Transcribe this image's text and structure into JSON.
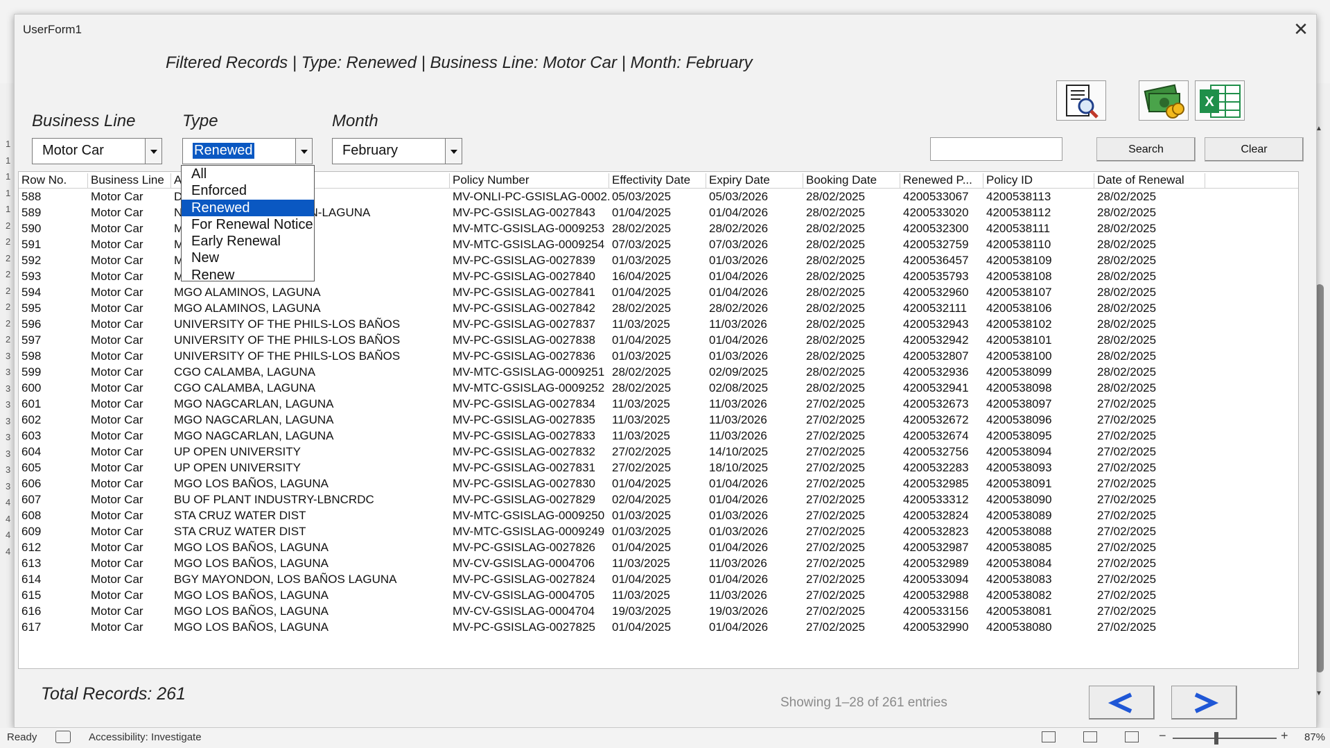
{
  "window": {
    "title": "UserForm1",
    "close_glyph": "✕"
  },
  "filter_title": "Filtered Records | Type: Renewed | Business Line: Motor Car | Month: February",
  "labels": {
    "business_line": "Business Line",
    "type": "Type",
    "month": "Month"
  },
  "business_line_select": {
    "value": "Motor Car"
  },
  "type_select": {
    "value": "Renewed",
    "options": [
      "All",
      "Enforced",
      "Renewed",
      "For Renewal Notice",
      "Early Renewal",
      "New",
      "Renew"
    ],
    "highlighted": "Renewed"
  },
  "month_select": {
    "value": "February"
  },
  "search": {
    "value": "",
    "button_label": "Search",
    "clear_label": "Clear"
  },
  "icons": {
    "preview": "report-search-icon",
    "money": "money-icon",
    "excel": "excel-icon"
  },
  "table": {
    "columns": [
      "Row No.",
      "Business Line",
      "A",
      "Policy Number",
      "Effectivity Date",
      "Expiry Date",
      "Booking Date",
      "Renewed P...",
      "Policy ID",
      "Date of Renewal"
    ],
    "rows": [
      [
        "588",
        "Motor Car",
        "D",
        "MV-ONLI-PC-GSISLAG-0002...",
        "05/03/2025",
        "05/03/2026",
        "28/02/2025",
        "4200533067",
        "4200538113",
        "28/02/2025"
      ],
      [
        "589",
        "Motor Car",
        "N                                    ON-LAGUNA",
        "MV-PC-GSISLAG-0027843",
        "01/04/2025",
        "01/04/2026",
        "28/02/2025",
        "4200533020",
        "4200538112",
        "28/02/2025"
      ],
      [
        "590",
        "Motor Car",
        "M",
        "MV-MTC-GSISLAG-0009253",
        "28/02/2025",
        "28/02/2026",
        "28/02/2025",
        "4200532300",
        "4200538111",
        "28/02/2025"
      ],
      [
        "591",
        "Motor Car",
        "M",
        "MV-MTC-GSISLAG-0009254",
        "07/03/2025",
        "07/03/2026",
        "28/02/2025",
        "4200532759",
        "4200538110",
        "28/02/2025"
      ],
      [
        "592",
        "Motor Car",
        "M",
        "MV-PC-GSISLAG-0027839",
        "01/03/2025",
        "01/03/2026",
        "28/02/2025",
        "4200536457",
        "4200538109",
        "28/02/2025"
      ],
      [
        "593",
        "Motor Car",
        "M                                    A",
        "MV-PC-GSISLAG-0027840",
        "16/04/2025",
        "01/04/2026",
        "28/02/2025",
        "4200535793",
        "4200538108",
        "28/02/2025"
      ],
      [
        "594",
        "Motor Car",
        "MGO ALAMINOS, LAGUNA",
        "MV-PC-GSISLAG-0027841",
        "01/04/2025",
        "01/04/2026",
        "28/02/2025",
        "4200532960",
        "4200538107",
        "28/02/2025"
      ],
      [
        "595",
        "Motor Car",
        "MGO ALAMINOS, LAGUNA",
        "MV-PC-GSISLAG-0027842",
        "28/02/2025",
        "28/02/2026",
        "28/02/2025",
        "4200532111",
        "4200538106",
        "28/02/2025"
      ],
      [
        "596",
        "Motor Car",
        "UNIVERSITY OF THE PHILS-LOS BAÑOS",
        "MV-PC-GSISLAG-0027837",
        "11/03/2025",
        "11/03/2026",
        "28/02/2025",
        "4200532943",
        "4200538102",
        "28/02/2025"
      ],
      [
        "597",
        "Motor Car",
        "UNIVERSITY OF THE PHILS-LOS BAÑOS",
        "MV-PC-GSISLAG-0027838",
        "01/04/2025",
        "01/04/2026",
        "28/02/2025",
        "4200532942",
        "4200538101",
        "28/02/2025"
      ],
      [
        "598",
        "Motor Car",
        "UNIVERSITY OF THE PHILS-LOS BAÑOS",
        "MV-PC-GSISLAG-0027836",
        "01/03/2025",
        "01/03/2026",
        "28/02/2025",
        "4200532807",
        "4200538100",
        "28/02/2025"
      ],
      [
        "599",
        "Motor Car",
        "CGO CALAMBA, LAGUNA",
        "MV-MTC-GSISLAG-0009251",
        "28/02/2025",
        "02/09/2025",
        "28/02/2025",
        "4200532936",
        "4200538099",
        "28/02/2025"
      ],
      [
        "600",
        "Motor Car",
        "CGO CALAMBA, LAGUNA",
        "MV-MTC-GSISLAG-0009252",
        "28/02/2025",
        "02/08/2025",
        "28/02/2025",
        "4200532941",
        "4200538098",
        "28/02/2025"
      ],
      [
        "601",
        "Motor Car",
        "MGO NAGCARLAN, LAGUNA",
        "MV-PC-GSISLAG-0027834",
        "11/03/2025",
        "11/03/2026",
        "27/02/2025",
        "4200532673",
        "4200538097",
        "27/02/2025"
      ],
      [
        "602",
        "Motor Car",
        "MGO NAGCARLAN, LAGUNA",
        "MV-PC-GSISLAG-0027835",
        "11/03/2025",
        "11/03/2026",
        "27/02/2025",
        "4200532672",
        "4200538096",
        "27/02/2025"
      ],
      [
        "603",
        "Motor Car",
        "MGO NAGCARLAN, LAGUNA",
        "MV-PC-GSISLAG-0027833",
        "11/03/2025",
        "11/03/2026",
        "27/02/2025",
        "4200532674",
        "4200538095",
        "27/02/2025"
      ],
      [
        "604",
        "Motor Car",
        "UP OPEN UNIVERSITY",
        "MV-PC-GSISLAG-0027832",
        "27/02/2025",
        "14/10/2025",
        "27/02/2025",
        "4200532756",
        "4200538094",
        "27/02/2025"
      ],
      [
        "605",
        "Motor Car",
        "UP OPEN UNIVERSITY",
        "MV-PC-GSISLAG-0027831",
        "27/02/2025",
        "18/10/2025",
        "27/02/2025",
        "4200532283",
        "4200538093",
        "27/02/2025"
      ],
      [
        "606",
        "Motor Car",
        "MGO LOS BAÑOS, LAGUNA",
        "MV-PC-GSISLAG-0027830",
        "01/04/2025",
        "01/04/2026",
        "27/02/2025",
        "4200532985",
        "4200538091",
        "27/02/2025"
      ],
      [
        "607",
        "Motor Car",
        "BU OF PLANT INDUSTRY-LBNCRDC",
        "MV-PC-GSISLAG-0027829",
        "02/04/2025",
        "01/04/2026",
        "27/02/2025",
        "4200533312",
        "4200538090",
        "27/02/2025"
      ],
      [
        "608",
        "Motor Car",
        "STA CRUZ WATER DIST",
        "MV-MTC-GSISLAG-0009250",
        "01/03/2025",
        "01/03/2026",
        "27/02/2025",
        "4200532824",
        "4200538089",
        "27/02/2025"
      ],
      [
        "609",
        "Motor Car",
        "STA CRUZ WATER DIST",
        "MV-MTC-GSISLAG-0009249",
        "01/03/2025",
        "01/03/2026",
        "27/02/2025",
        "4200532823",
        "4200538088",
        "27/02/2025"
      ],
      [
        "612",
        "Motor Car",
        "MGO LOS BAÑOS, LAGUNA",
        "MV-PC-GSISLAG-0027826",
        "01/04/2025",
        "01/04/2026",
        "27/02/2025",
        "4200532987",
        "4200538085",
        "27/02/2025"
      ],
      [
        "613",
        "Motor Car",
        "MGO LOS BAÑOS, LAGUNA",
        "MV-CV-GSISLAG-0004706",
        "11/03/2025",
        "11/03/2026",
        "27/02/2025",
        "4200532989",
        "4200538084",
        "27/02/2025"
      ],
      [
        "614",
        "Motor Car",
        "BGY MAYONDON, LOS BAÑOS LAGUNA",
        "MV-PC-GSISLAG-0027824",
        "01/04/2025",
        "01/04/2026",
        "27/02/2025",
        "4200533094",
        "4200538083",
        "27/02/2025"
      ],
      [
        "615",
        "Motor Car",
        "MGO LOS BAÑOS, LAGUNA",
        "MV-CV-GSISLAG-0004705",
        "11/03/2025",
        "11/03/2026",
        "27/02/2025",
        "4200532988",
        "4200538082",
        "27/02/2025"
      ],
      [
        "616",
        "Motor Car",
        "MGO LOS BAÑOS, LAGUNA",
        "MV-CV-GSISLAG-0004704",
        "19/03/2025",
        "19/03/2026",
        "27/02/2025",
        "4200533156",
        "4200538081",
        "27/02/2025"
      ],
      [
        "617",
        "Motor Car",
        "MGO LOS BAÑOS, LAGUNA",
        "MV-PC-GSISLAG-0027825",
        "01/04/2025",
        "01/04/2026",
        "27/02/2025",
        "4200532990",
        "4200538080",
        "27/02/2025"
      ]
    ]
  },
  "footer": {
    "total_records": "Total Records: 261",
    "showing": "Showing 1–28 of 261 entries",
    "prev_glyph": "◀",
    "next_glyph": "▶"
  },
  "statusbar": {
    "ready": "Ready",
    "accessibility": "Accessibility: Investigate",
    "zoom": "87%",
    "zoom_minus": "−",
    "zoom_plus": "+"
  },
  "excel_row_numbers": [
    "1",
    "1",
    "1",
    "1",
    "1",
    "2",
    "2",
    "2",
    "2",
    "2",
    "2",
    "2",
    "2",
    "3",
    "3",
    "3",
    "3",
    "3",
    "3",
    "3",
    "3",
    "3",
    "4",
    "4",
    "4",
    "4"
  ],
  "colors": {
    "selection_blue": "#0a58c2",
    "nav_arrow_blue": "#1f57d6",
    "excel_green": "#1f8f4a"
  }
}
